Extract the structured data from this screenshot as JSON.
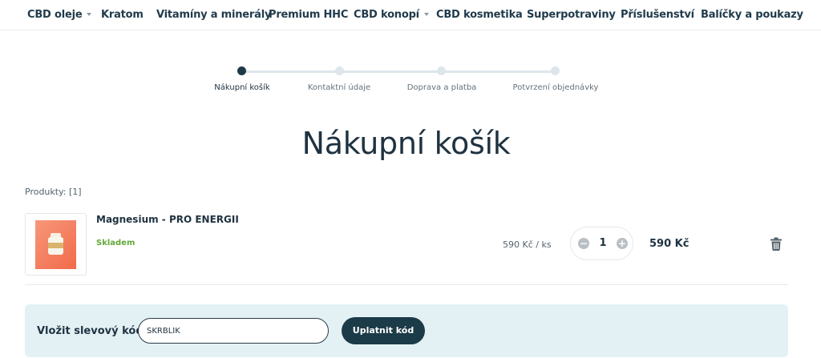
{
  "nav": {
    "items": [
      {
        "label": "CBD oleje",
        "has_dropdown": true
      },
      {
        "label": "Kratom",
        "has_dropdown": false
      },
      {
        "label": "Vitamíny a minerály",
        "has_dropdown": false
      },
      {
        "label": "Premium HHC",
        "has_dropdown": false
      },
      {
        "label": "CBD konopí",
        "has_dropdown": true
      },
      {
        "label": "CBD kosmetika",
        "has_dropdown": false
      },
      {
        "label": "Superpotraviny",
        "has_dropdown": false
      },
      {
        "label": "Příslušenství",
        "has_dropdown": false
      },
      {
        "label": "Balíčky a poukazy",
        "has_dropdown": false
      }
    ]
  },
  "steps": {
    "active_index": 0,
    "items": [
      {
        "label": "Nákupní košík"
      },
      {
        "label": "Kontaktní údaje"
      },
      {
        "label": "Doprava a platba"
      },
      {
        "label": "Potvrzení objednávky"
      }
    ]
  },
  "page_title": "Nákupní košík",
  "products_count": "Produkty: [1]",
  "cart": {
    "items": [
      {
        "name": "Magnesium - PRO ENERGII",
        "stock": "Skladem",
        "unit_price": "590 Kč / ks",
        "quantity": "1",
        "qty_minus": "−",
        "qty_plus": "+",
        "total": "590 Kč",
        "remove_icon": "trash-icon"
      }
    ]
  },
  "coupon": {
    "label": "Vložit slevový kód",
    "value": "SKRBLÍK",
    "button": "Uplatnit kód"
  },
  "colors": {
    "accent": "#1c3b48",
    "stock_green": "#63a83a",
    "coupon_bg": "#e3f1f5"
  }
}
